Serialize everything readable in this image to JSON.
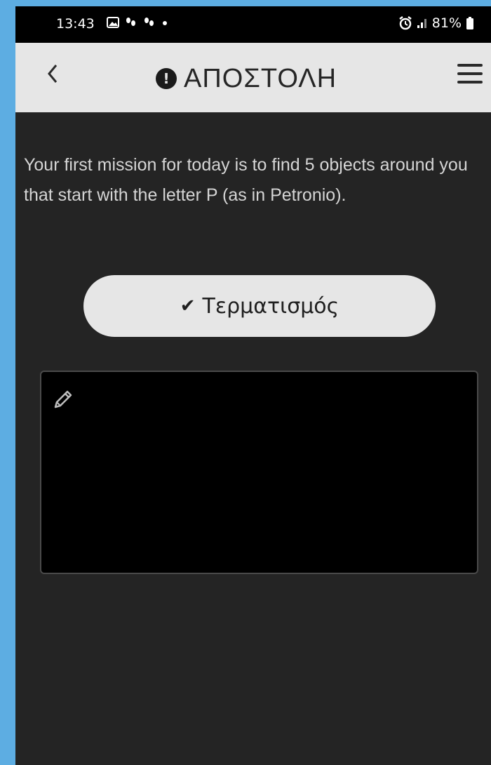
{
  "status_bar": {
    "time": "13:43",
    "battery": "81%",
    "icons": [
      "gallery-icon",
      "footsteps-icon",
      "footsteps-icon",
      "dot-icon",
      "alarm-icon",
      "signal-icon",
      "battery-icon"
    ]
  },
  "header": {
    "title": "ΑΠΟΣΤΟΛΗ",
    "alert_glyph": "!",
    "back_glyph": "<"
  },
  "mission": {
    "text": "Your first mission for today is to find 5 objects around you that start with the letter P (as in Petronio)."
  },
  "finish_button": {
    "label": "Τερματισμός",
    "icon": "check-icon"
  },
  "notes": {
    "icon": "pencil-icon",
    "value": ""
  },
  "colors": {
    "page_border": "#5dade2",
    "background": "#242424",
    "header": "#e6e6e6",
    "text": "#d5d5d5",
    "button": "#e6e6e6"
  }
}
